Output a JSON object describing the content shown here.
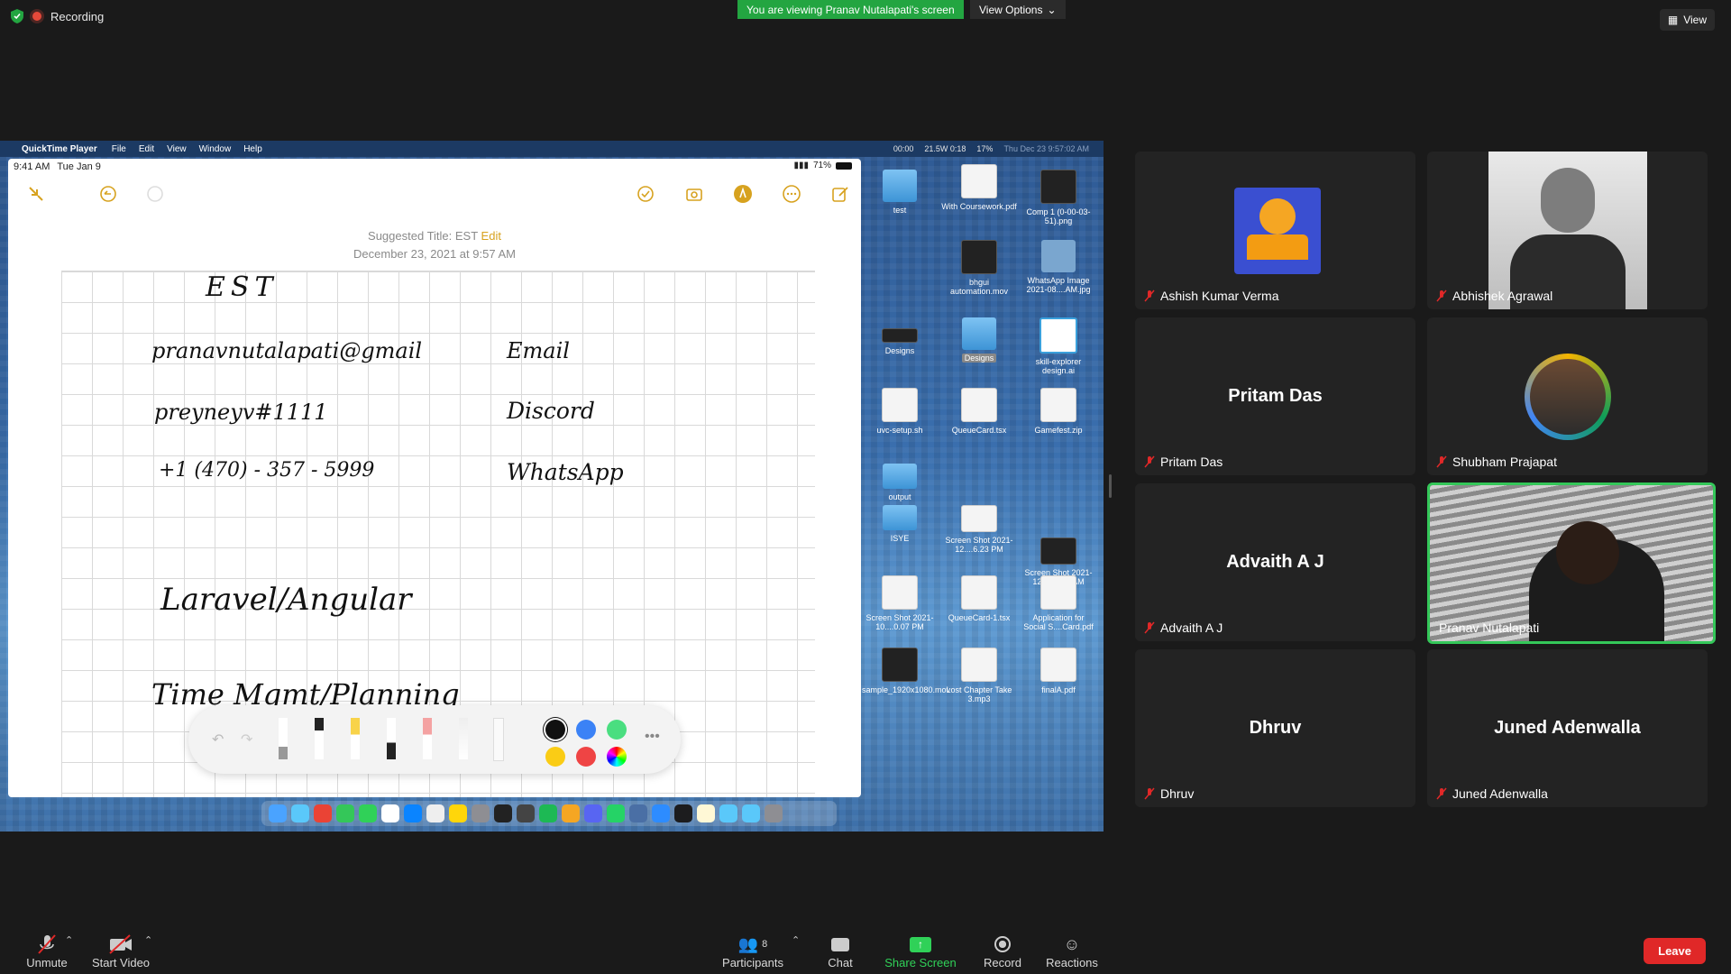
{
  "top": {
    "recording_label": "Recording",
    "viewing_banner": "You are viewing Pranav Nutalapati's screen",
    "view_options": "View Options",
    "view_button": "View"
  },
  "mac": {
    "app_name": "QuickTime Player",
    "menu": [
      "File",
      "Edit",
      "View",
      "Window",
      "Help"
    ],
    "menu_status_time": "00:00",
    "power_info": "21.5W 0:18",
    "battery": "17%",
    "datetime": "Thu Dec 23  9:57:02 AM"
  },
  "ipad": {
    "status_time": "9:41 AM",
    "status_date": "Tue Jan 9",
    "battery": "71%",
    "suggested_title_label": "Suggested Title: EST",
    "edit_label": "Edit",
    "note_date": "December 23, 2021 at 9:57 AM",
    "handwriting": {
      "title": "EST",
      "email_value": "pranavnutalapati@gmail",
      "email_label": "Email",
      "discord_value": "preyneyv#1111",
      "discord_label": "Discord",
      "phone_value": "+1 (470) - 357 - 5999",
      "phone_label": "WhatsApp",
      "stack": "Laravel/Angular",
      "time": "Time Mgmt/Planning"
    },
    "colors": [
      "#111111",
      "#3b82f6",
      "#4ade80",
      "#facc15",
      "#ef4444"
    ]
  },
  "desktop_icons": [
    {
      "label": "test"
    },
    {
      "label": "With Coursework.pdf"
    },
    {
      "label": "Comp 1 (0-00-03-51).png"
    },
    {
      "label": "bhgui automation.mov"
    },
    {
      "label": "WhatsApp Image 2021-08....AM.jpg"
    },
    {
      "label": "Designs"
    },
    {
      "label": "Designs"
    },
    {
      "label": "skill-explorer design.ai"
    },
    {
      "label": "uvc-setup.sh"
    },
    {
      "label": "QueueCard.tsx"
    },
    {
      "label": "Gamefest.zip"
    },
    {
      "label": "output"
    },
    {
      "label": "ISYE"
    },
    {
      "label": "Screen Shot 2021-12....6.23 PM"
    },
    {
      "label": "Screen Shot 2021-12....11.05 AM"
    },
    {
      "label": "Screen Shot 2021-10....0.07 PM"
    },
    {
      "label": "QueueCard-1.tsx"
    },
    {
      "label": "Application for Social S....Card.pdf"
    },
    {
      "label": "sample_1920x1080.mov"
    },
    {
      "label": "Lost Chapter Take 3.mp3"
    },
    {
      "label": "finalA.pdf"
    }
  ],
  "participants": [
    {
      "name": "Ashish Kumar Verma",
      "type": "avatar"
    },
    {
      "name": "Abhishek Agrawal",
      "type": "photo"
    },
    {
      "name": "Pritam Das",
      "type": "name"
    },
    {
      "name": "Shubham Prajapat",
      "type": "avatar"
    },
    {
      "name": "Advaith A J",
      "type": "name"
    },
    {
      "name": "Pranav Nutalapati",
      "type": "video"
    },
    {
      "name": "Dhruv",
      "type": "name"
    },
    {
      "name": "Juned Adenwalla",
      "type": "name"
    }
  ],
  "toolbar": {
    "unmute": "Unmute",
    "start_video": "Start Video",
    "participants_label": "Participants",
    "participants_count": "8",
    "chat": "Chat",
    "share_screen": "Share Screen",
    "record": "Record",
    "reactions": "Reactions",
    "leave": "Leave"
  }
}
